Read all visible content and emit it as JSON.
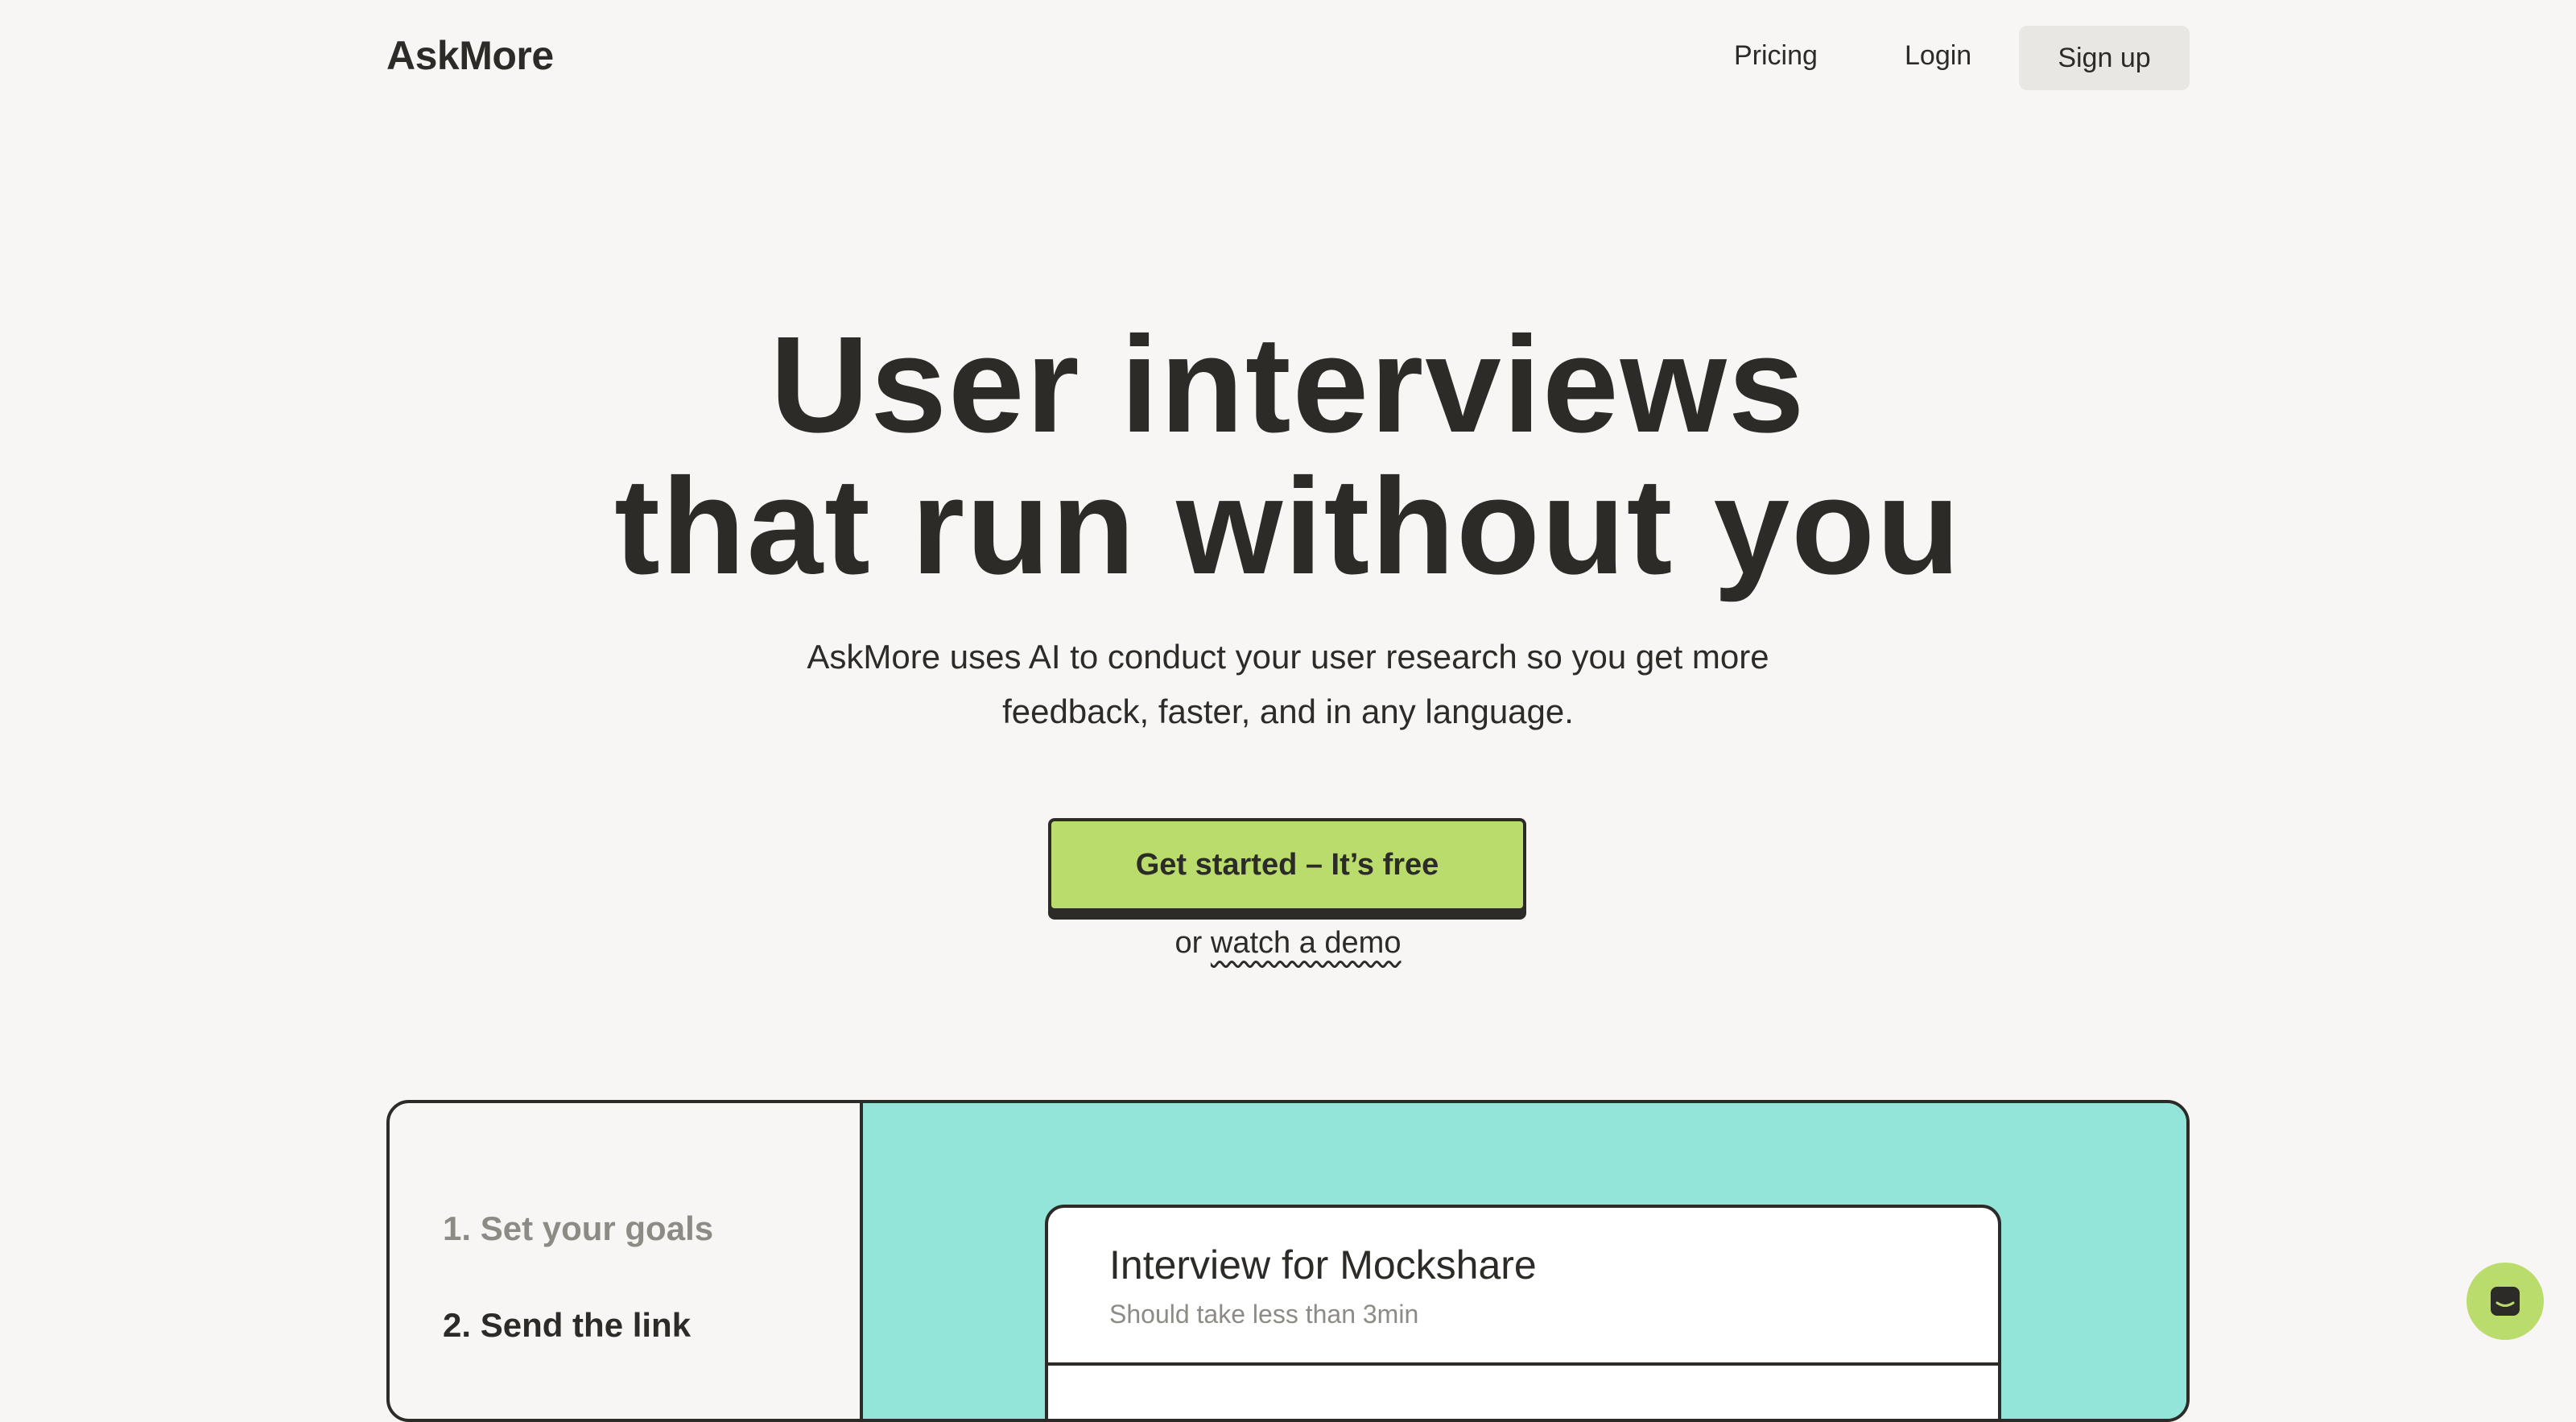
{
  "header": {
    "logo": "AskMore",
    "nav": {
      "pricing": "Pricing",
      "login": "Login",
      "signup": "Sign up"
    }
  },
  "hero": {
    "title_line1": "User interviews",
    "title_line2": "that run without you",
    "subtitle_line1": "AskMore uses AI to conduct your user research so you get more",
    "subtitle_line2": "feedback, faster, and in any language.",
    "cta_label": "Get started – It’s free",
    "demo_prefix": "or",
    "demo_link": "watch a demo"
  },
  "demo_panel": {
    "steps": [
      {
        "label": "1. Set your goals"
      },
      {
        "label": "2. Send the link"
      }
    ],
    "card": {
      "title": "Interview for Mockshare",
      "subtitle": "Should take less than 3min"
    }
  },
  "chat_widget": {
    "icon": "chat-icon"
  },
  "colors": {
    "background": "#f7f6f4",
    "text": "#2c2b28",
    "accent_green": "#b9dc6c",
    "panel_teal": "#93e4d9",
    "muted": "#8d8b86"
  }
}
